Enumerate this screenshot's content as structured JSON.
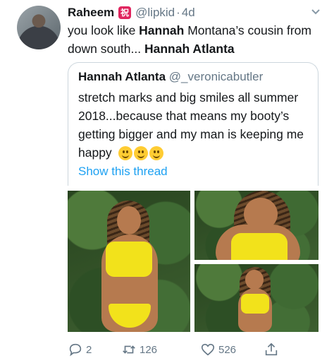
{
  "tweet": {
    "author_name": "Raheem",
    "badge_glyph": "祝",
    "handle": "@lipkid",
    "separator": "·",
    "time": "4d",
    "text_parts": [
      {
        "t": "you look like ",
        "bold": false
      },
      {
        "t": "Hannah",
        "bold": true
      },
      {
        "t": " Montana’s cousin from down south... ",
        "bold": false
      },
      {
        "t": "Hannah Atlanta",
        "bold": true
      }
    ]
  },
  "quote": {
    "author_name": "Hannah Atlanta",
    "handle": "@_veronicabutler",
    "text": "stretch marks and big smiles all summer 2018...because that means my booty’s getting bigger and my man is keeping me happy",
    "show_thread": "Show this thread"
  },
  "actions": {
    "reply_count": "2",
    "retweet_count": "126",
    "like_count": "526"
  },
  "colors": {
    "accent": "#1da1f2",
    "muted": "#657786",
    "badge": "#e0245e"
  },
  "icons": [
    "chevron-down-icon",
    "reply-icon",
    "retweet-icon",
    "like-icon",
    "share-icon"
  ]
}
